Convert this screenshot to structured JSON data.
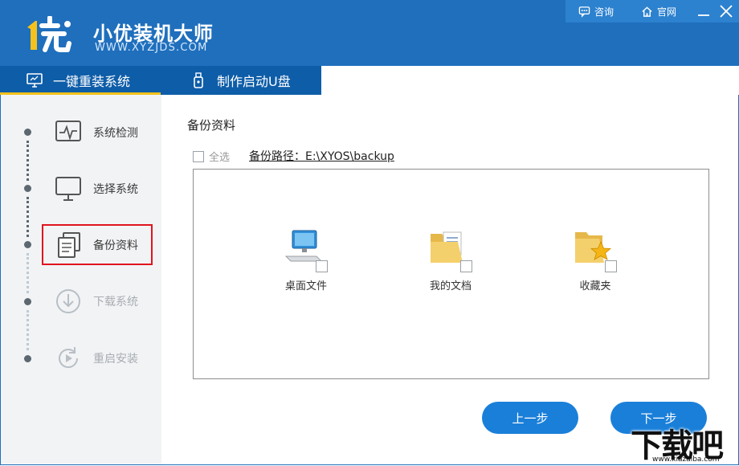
{
  "app": {
    "title": "小优装机大师",
    "url": "WWW.XYZJDS.COM",
    "logo_text": "1优"
  },
  "topbar": {
    "consult_label": "咨询",
    "website_label": "官网",
    "minimize": "—",
    "close": "✕"
  },
  "tabs": [
    {
      "label": "一键重装系统",
      "icon": "monitor-icon",
      "active": true
    },
    {
      "label": "制作启动U盘",
      "icon": "usb-icon",
      "active": false
    }
  ],
  "steps": [
    {
      "label": "系统检测",
      "icon": "pulse-monitor-icon",
      "state": "done"
    },
    {
      "label": "选择系统",
      "icon": "monitor-icon",
      "state": "done"
    },
    {
      "label": "备份资料",
      "icon": "documents-icon",
      "state": "current"
    },
    {
      "label": "下载系统",
      "icon": "download-icon",
      "state": "pending"
    },
    {
      "label": "重启安装",
      "icon": "restart-icon",
      "state": "pending"
    }
  ],
  "main": {
    "title": "备份资料",
    "select_all_label": "全选",
    "backup_path_label": "备份路径：E:\\XYOS\\backup",
    "items": [
      {
        "label": "桌面文件",
        "icon": "desktop-computer-icon"
      },
      {
        "label": "我的文档",
        "icon": "documents-folder-icon"
      },
      {
        "label": "收藏夹",
        "icon": "favorites-folder-icon"
      }
    ],
    "prev_button": "上一步",
    "next_button": "下一步"
  },
  "watermark": {
    "text": "下载吧",
    "url": "www.xiazaiba.com"
  },
  "colors": {
    "header": "#1f6fbd",
    "tabbar": "#0e5da8",
    "accent": "#f5c11b",
    "button": "#1a7fd9",
    "highlight_border": "#e0141e"
  }
}
